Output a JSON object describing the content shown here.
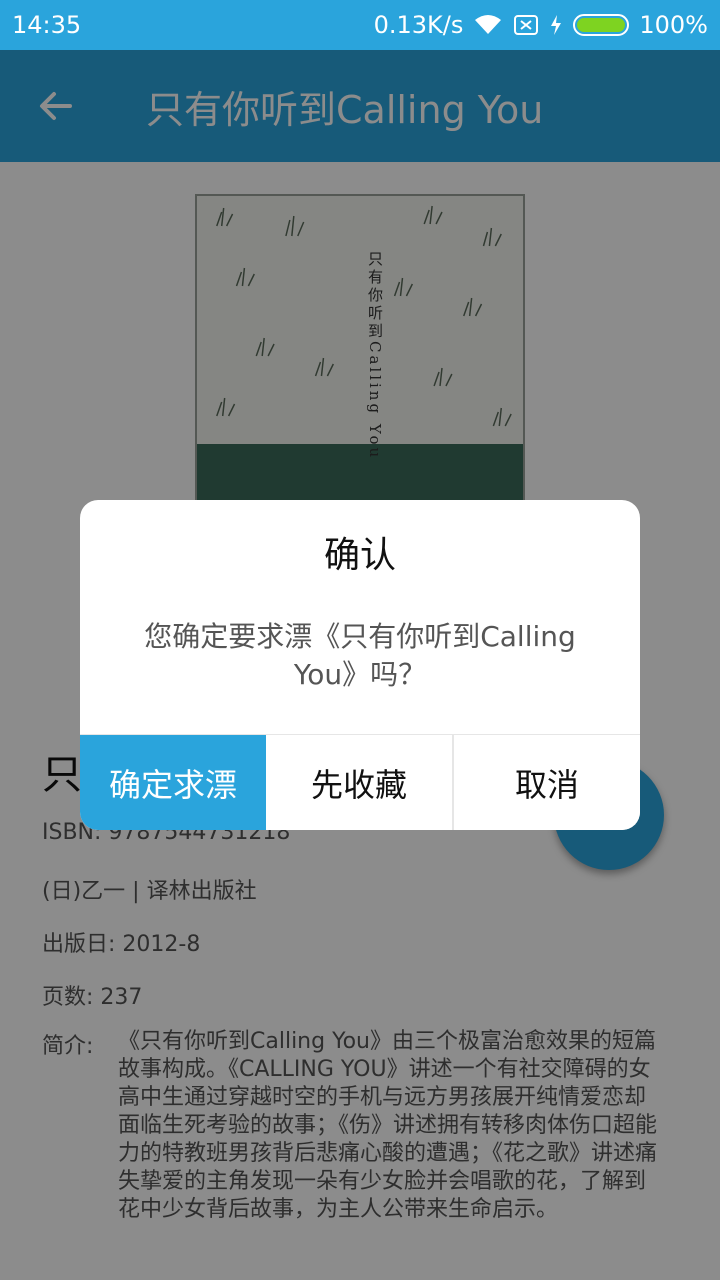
{
  "status_bar": {
    "time": "14:35",
    "network_speed": "0.13K/s",
    "battery": "100%",
    "battery_level": 1.0,
    "icons": [
      "wifi-icon",
      "no-sim-icon",
      "charging-icon",
      "battery-icon"
    ]
  },
  "app_bar": {
    "title": "只有你听到Calling You",
    "back_icon": "arrow-left-icon"
  },
  "book": {
    "title_prefix": "只",
    "isbn": "ISBN: 9787544731218",
    "author_publisher": "(日)乙一 | 译林出版社",
    "publish_date": "出版日: 2012-8",
    "pages": "页数: 237",
    "summary_label": "简介:",
    "summary": "《只有你听到Calling You》由三个极富治愈效果的短篇故事构成。《CALLING YOU》讲述一个有社交障碍的女高中生通过穿越时空的手机与远方男孩展开纯情爱恋却面临生死考验的故事；《伤》讲述拥有转移肉体伤口超能力的特教班男孩背后悲痛心酸的遭遇；《花之歌》讲述痛失挚爱的主角发现一朵有少女脸并会唱歌的花，了解到花中少女背后故事，为主人公带来生命启示。"
  },
  "dialog": {
    "title": "确认",
    "message": "您确定要求漂《只有你听到Calling You》吗？",
    "buttons": {
      "confirm": "确定求漂",
      "collect": "先收藏",
      "cancel": "取消"
    }
  },
  "colors": {
    "accent": "#2aa4dc",
    "overlay": "rgba(0,0,0,0.45)"
  }
}
